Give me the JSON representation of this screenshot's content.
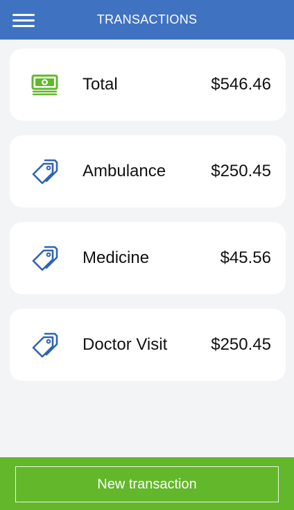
{
  "header": {
    "title": "TRANSACTIONS",
    "menu_icon": "hamburger-menu-icon"
  },
  "summary": {
    "icon": "money-icon",
    "label": "Total",
    "amount": "$546.46"
  },
  "transactions": [
    {
      "icon": "tag-icon",
      "label": "Ambulance",
      "amount": "$250.45"
    },
    {
      "icon": "tag-icon",
      "label": "Medicine",
      "amount": "$45.56"
    },
    {
      "icon": "tag-icon",
      "label": "Doctor Visit",
      "amount": "$250.45"
    }
  ],
  "footer": {
    "new_button_label": "New transaction"
  },
  "colors": {
    "header_bg": "#3f72c1",
    "footer_bg": "#63b72b",
    "money_icon": "#63b72b",
    "tag_icon": "#2e63b6",
    "page_bg": "#f3f4f6"
  }
}
